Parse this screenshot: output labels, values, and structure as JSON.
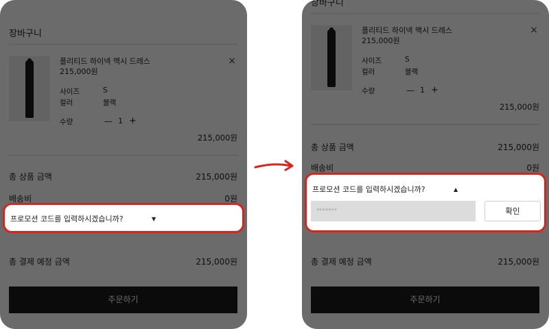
{
  "cart": {
    "title": "장바구니",
    "item": {
      "name": "플리티드 하이넥 맥시 드레스",
      "price": "215,000원",
      "size_label": "사이즈",
      "size_value": "S",
      "color_label": "컬러",
      "color_value": "블랙",
      "qty_label": "수량",
      "qty_minus": "—",
      "qty_value": "1",
      "qty_plus": "+",
      "remove_icon": "×",
      "total": "215,000원"
    },
    "summary": {
      "subtotal_label": "총 상품 금액",
      "subtotal_value": "215,000원",
      "shipping_label": "배송비",
      "shipping_value": "0원",
      "grand_label": "총 결제 예정 금액",
      "grand_value": "215,000원"
    },
    "promo": {
      "question": "프로모션 코드를 입력하시겠습니까?",
      "caret_collapsed": "▼",
      "caret_expanded": "▲",
      "input_value": "*******",
      "confirm_label": "확인"
    },
    "order_label": "주문하기"
  },
  "colors": {
    "highlight": "#e0211a",
    "order_button": "#1b1b1b",
    "overlay": "rgba(0,0,0,0.58)"
  },
  "icons": {
    "transition_arrow": "arrow-right-icon",
    "remove": "close-icon",
    "caret_down": "caret-down-icon",
    "caret_up": "caret-up-icon"
  }
}
